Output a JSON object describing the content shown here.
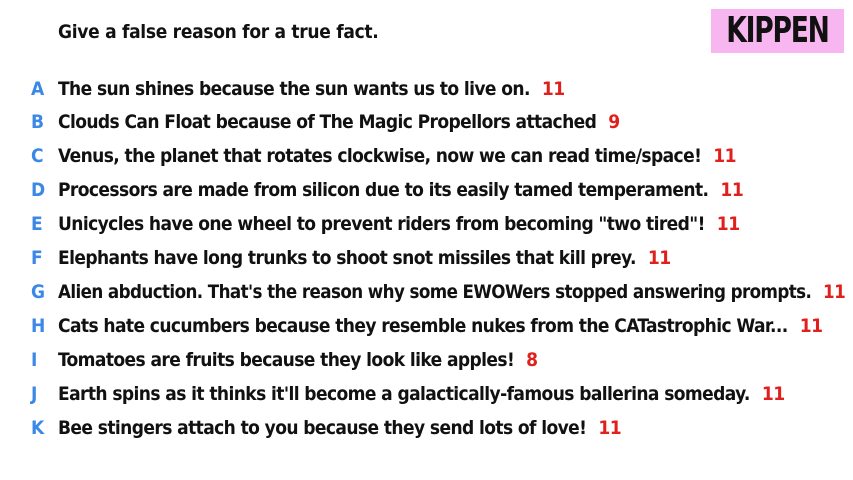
{
  "prompt": "Give a false reason for a true fact.",
  "player_name": "KIPPEN",
  "answers": [
    {
      "letter": "A",
      "text": "The sun shines because the sun wants us to live on.",
      "score": "11"
    },
    {
      "letter": "B",
      "text": "Clouds Can Float because of The Magic Propellors attached",
      "score": "9"
    },
    {
      "letter": "C",
      "text": "Venus, the planet that rotates clockwise, now we can read time/space!",
      "score": "11"
    },
    {
      "letter": "D",
      "text": "Processors are made from silicon due to its easily tamed temperament.",
      "score": "11"
    },
    {
      "letter": "E",
      "text": "Unicycles have one wheel to prevent riders from becoming \"two tired\"!",
      "score": "11"
    },
    {
      "letter": "F",
      "text": "Elephants have long trunks to shoot snot missiles that kill prey.",
      "score": "11"
    },
    {
      "letter": "G",
      "text": "Alien abduction. That's the reason why some EWOWers stopped answering prompts.",
      "score": "11"
    },
    {
      "letter": "H",
      "text": "Cats hate cucumbers because they resemble nukes from the CATastrophic War...",
      "score": "11"
    },
    {
      "letter": "I",
      "text": "Tomatoes are fruits because they look like apples!",
      "score": "8"
    },
    {
      "letter": "J",
      "text": "Earth spins as it thinks it'll become a galactically-famous ballerina someday.",
      "score": "11"
    },
    {
      "letter": "K",
      "text": "Bee stingers attach to you because they send lots of love!",
      "score": "11"
    }
  ],
  "colors": {
    "letter": "#3b88e6",
    "score": "#e0201c",
    "badge_bg": "#f7b6f0"
  }
}
